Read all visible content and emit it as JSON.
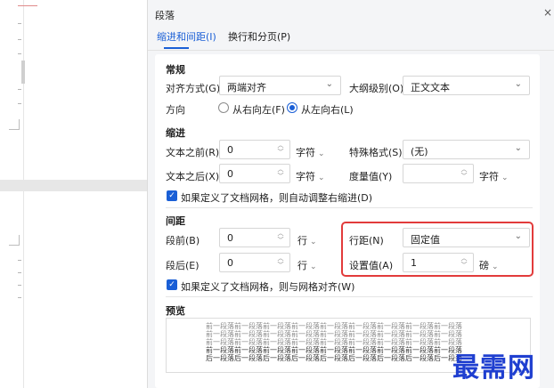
{
  "dialog": {
    "title": "段落",
    "close": "×",
    "tabs": [
      "缩进和间距(I)",
      "换行和分页(P)"
    ]
  },
  "general": {
    "heading": "常规",
    "alignment_label": "对齐方式(G)",
    "alignment_value": "两端对齐",
    "outline_label": "大纲级别(O)",
    "outline_value": "正文文本",
    "direction_label": "方向",
    "rtl_label": "从右向左(F)",
    "ltr_label": "从左向右(L)"
  },
  "indent": {
    "heading": "缩进",
    "before_label": "文本之前(R)",
    "before_value": "0",
    "before_unit": "字符",
    "after_label": "文本之后(X)",
    "after_value": "0",
    "after_unit": "字符",
    "special_label": "特殊格式(S)",
    "special_value": "(无)",
    "measure_label": "度量值(Y)",
    "measure_value": "",
    "measure_unit": "字符",
    "grid_check_label": "如果定义了文档网格，则自动调整右缩进(D)"
  },
  "spacing": {
    "heading": "间距",
    "before_label": "段前(B)",
    "before_value": "0",
    "before_unit": "行",
    "after_label": "段后(E)",
    "after_value": "0",
    "after_unit": "行",
    "line_label": "行距(N)",
    "line_value": "固定值",
    "setting_label": "设置值(A)",
    "setting_value": "1",
    "setting_unit": "磅",
    "grid_check_label": "如果定义了文档网格，则与网格对齐(W)"
  },
  "preview": {
    "heading": "预览",
    "lines": [
      "前一段落前一段落前一段落前一段落前一段落前一段落前一段落前一段落前一段落",
      "前一段落前一段落前一段落前一段落前一段落前一段落前一段落前一段落前一段落",
      "前一段落前一段落前一段落前一段落前一段落前一段落前一段落前一段落前一段落",
      "前一段落前一段落前一段落前一段落前一段落前一段落前一段落前一段落前一段落",
      "后一段落后一段落后一段落后一段落后一段落后一段落后一段落后一段落后一段落"
    ]
  },
  "watermark": "最需网",
  "colors": {
    "accent": "#1a5fd6",
    "highlight": "#e23b3b",
    "watermark": "#1f3fd0"
  },
  "icons": {
    "dropdown": "chevron-down-icon",
    "spinner": "spinner-arrows-icon",
    "check": "checkmark-icon",
    "close": "close-icon"
  }
}
